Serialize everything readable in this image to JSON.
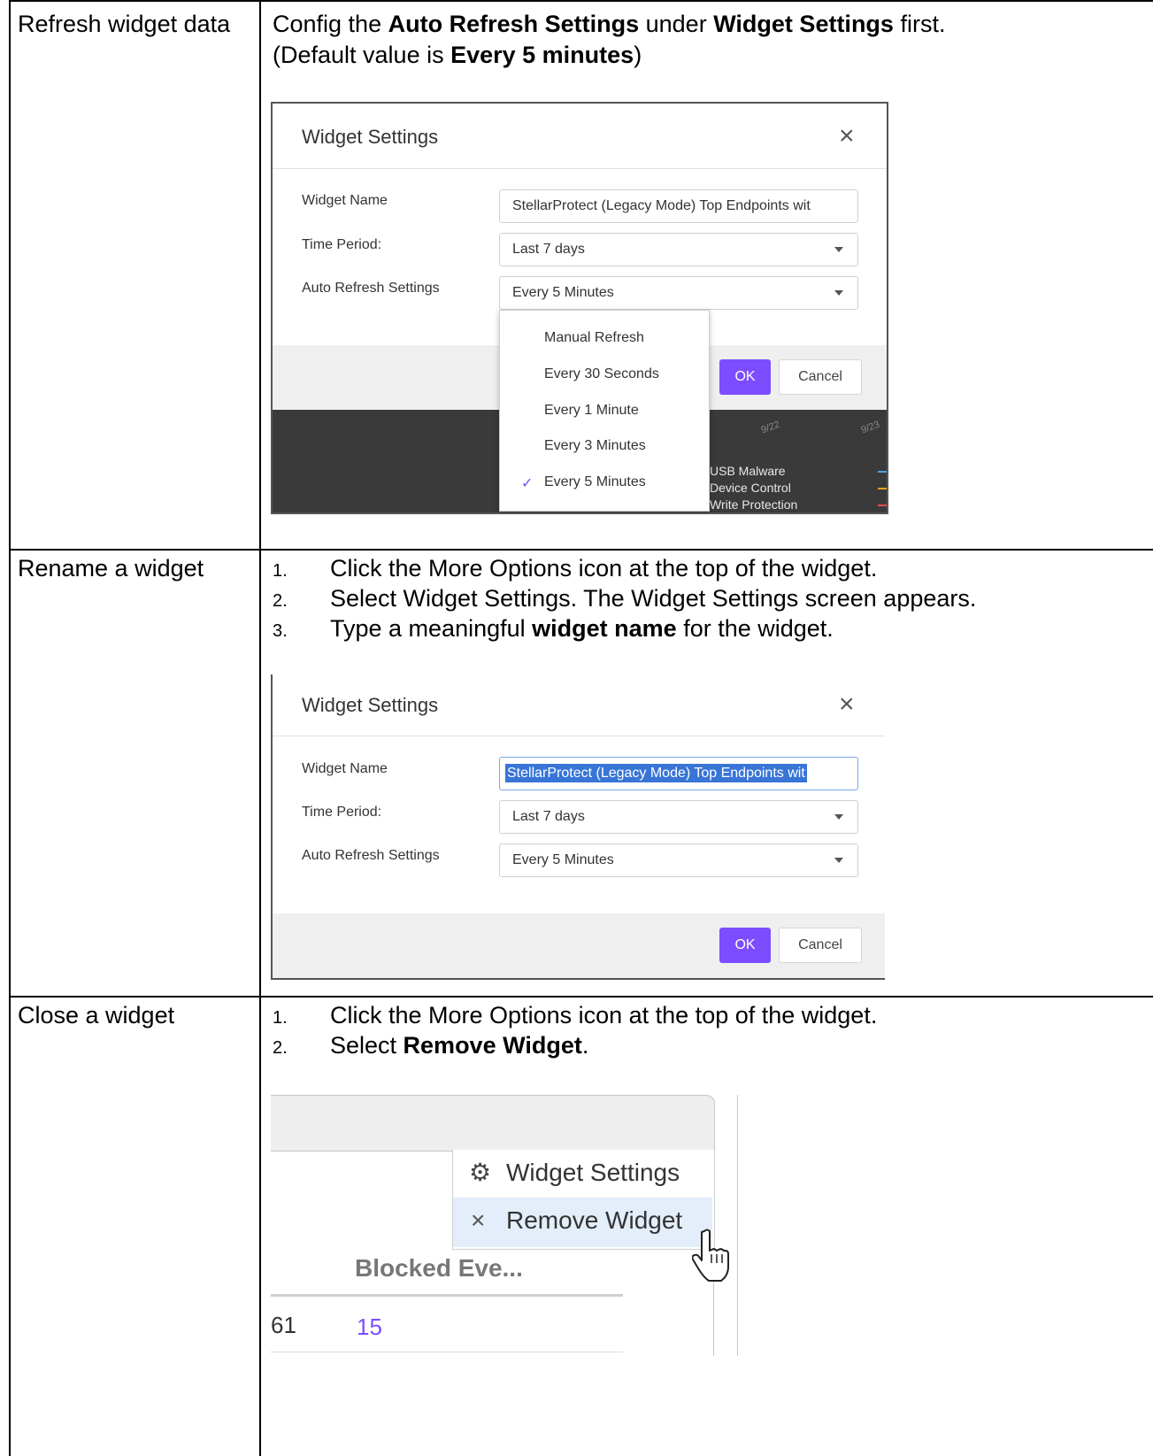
{
  "rows": [
    {
      "label": "Refresh widget data",
      "intro_parts": [
        "Config the ",
        "Auto Refresh Settings",
        " under ",
        "Widget Settings",
        " first."
      ],
      "intro2_parts": [
        "(Default value is ",
        "Every 5 minutes",
        ")"
      ],
      "dialog": {
        "title": "Widget Settings",
        "fields": [
          {
            "label": "Widget Name",
            "value": "StellarProtect (Legacy Mode) Top Endpoints wit"
          },
          {
            "label": "Time Period:",
            "value": "Last 7 days"
          },
          {
            "label": "Auto Refresh Settings",
            "value": "Every 5 Minutes"
          }
        ],
        "ok": "OK",
        "cancel": "Cancel",
        "dropdown_options": [
          "Manual Refresh",
          "Every 30 Seconds",
          "Every 1 Minute",
          "Every 3 Minutes",
          "Every 5 Minutes"
        ],
        "selected_option": "Every 5 Minutes",
        "background_axis": [
          "9/22",
          "9/23"
        ],
        "background_legend": [
          {
            "text": "USB Malware",
            "color": "#4aa3df"
          },
          {
            "text": "Device Control",
            "color": "#f0a020"
          },
          {
            "text": "Write Protection",
            "color": "#e05050"
          }
        ]
      }
    },
    {
      "label": "Rename a widget",
      "steps": [
        {
          "num": "1.",
          "parts": [
            "Click the More Options icon at the top of the widget."
          ]
        },
        {
          "num": "2.",
          "parts": [
            "Select Widget Settings. The Widget Settings screen appears."
          ]
        },
        {
          "num": "3.",
          "parts": [
            "Type a meaningful ",
            "widget name",
            " for the widget."
          ]
        }
      ],
      "dialog": {
        "title": "Widget Settings",
        "fields": [
          {
            "label": "Widget Name",
            "value": "StellarProtect (Legacy Mode) Top Endpoints wit"
          },
          {
            "label": "Time Period:",
            "value": "Last 7 days"
          },
          {
            "label": "Auto Refresh Settings",
            "value": "Every 5 Minutes"
          }
        ],
        "ok": "OK",
        "cancel": "Cancel"
      }
    },
    {
      "label": "Close a widget",
      "steps": [
        {
          "num": "1.",
          "parts": [
            "Click the More Options icon at the top of the widget."
          ]
        },
        {
          "num": "2.",
          "parts": [
            "Select ",
            "Remove Widget",
            "."
          ]
        }
      ],
      "menu": {
        "settings": "Widget Settings",
        "remove": "Remove Widget",
        "column_header": "Blocked Eve...",
        "cell_left": "61",
        "cell_value": "15",
        "link_color": "#7c4dff"
      }
    }
  ]
}
